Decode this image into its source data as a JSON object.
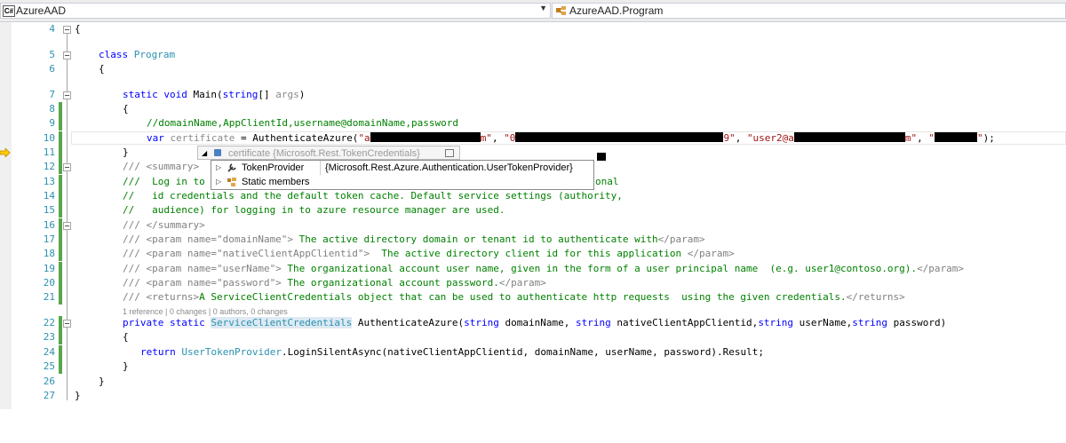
{
  "navbar": {
    "project_icon": "C#",
    "project": "AzureAAD",
    "class_name": "AzureAAD.Program"
  },
  "lines": {
    "l4": {
      "num": "4",
      "code": "{"
    },
    "l5": {
      "num": "5",
      "kw": "class ",
      "ty": "Program"
    },
    "l6": {
      "num": "6",
      "code": "{"
    },
    "l7": {
      "num": "7",
      "kw1": "static ",
      "kw2": "void ",
      "name": "Main(",
      "kw3": "string",
      "rest": "[] ",
      "gray": "args",
      "end": ")"
    },
    "l8": {
      "num": "8",
      "code": "{"
    },
    "l9": {
      "num": "9",
      "comment": "//domainName,AppClientId,username@domainName,password"
    },
    "l10": {
      "num": "10",
      "kw": "var ",
      "var_name": "certificate",
      "mid": " = AuthenticateAzure(",
      "s1a": "\"a",
      "s1b": "m\"",
      "sep1": ", ",
      "s2a": "\"0",
      "s2b": "9\"",
      "sep2": ", ",
      "s3a": "\"user2@a",
      "s3b": "m\"",
      "sep3": ", ",
      "s4a": "\"",
      "s4b": "\"",
      "end": ");"
    },
    "l11": {
      "num": "11",
      "code": "}"
    },
    "l12": {
      "num": "12",
      "code": "/// <summary>"
    },
    "l13": {
      "num": "13",
      "start": "///  Log in to",
      "end": "onal"
    },
    "l14": {
      "num": "14",
      "code": "//   id credentials and the default token cache. Default service settings (authority,"
    },
    "l15": {
      "num": "15",
      "code": "//   audience) for logging in to azure resource manager are used."
    },
    "l16": {
      "num": "16",
      "code": "/// </summary>"
    },
    "l17": {
      "num": "17",
      "tag": "/// <param name=\"domainName\">",
      "text": " The active directory domain or tenant id to authenticate with",
      "close": "</param>"
    },
    "l18": {
      "num": "18",
      "tag": "/// <param name=\"nativeClientAppClientid\">",
      "text": "  The active directory client id for this application ",
      "close": "</param>"
    },
    "l19": {
      "num": "19",
      "tag": "/// <param name=\"userName\">",
      "text": " The organizational account user name, given in the form of a user principal name  (e.g. user1@contoso.org).",
      "close": "</param>"
    },
    "l20": {
      "num": "20",
      "tag": "/// <param name=\"password\">",
      "text": " The organizational account password.",
      "close": "</param>"
    },
    "l21": {
      "num": "21",
      "tag": "/// <returns>",
      "text": "A ServiceClientCredentials object that can be used to authenticate http requests  using the given credentials.",
      "close": "</returns>"
    },
    "lens": "1 reference | 0 changes | 0 authors, 0 changes",
    "l22": {
      "num": "22",
      "kw1": "private ",
      "kw2": "static ",
      "ty": "ServiceClientCredentials",
      "mid": " AuthenticateAzure(",
      "kw3": "string",
      "p1": " domainName, ",
      "kw4": "string",
      "p2": " nativeClientAppClientid,",
      "kw5": "string",
      "p3": " userName,",
      "kw6": "string",
      "p4": " password)"
    },
    "l23": {
      "num": "23",
      "code": "{"
    },
    "l24": {
      "num": "24",
      "kw": "return ",
      "ty": "UserTokenProvider",
      "rest": ".LoginSilentAsync(nativeClientAppClientid, domainName, userName, password).Result;"
    },
    "l25": {
      "num": "25",
      "code": "}"
    },
    "l26": {
      "num": "26",
      "code": "}"
    },
    "l27": {
      "num": "27",
      "code": "}"
    }
  },
  "datatip": {
    "expand": "◢",
    "name": "certificate",
    "type": "{Microsoft.Rest.TokenCredentials}"
  },
  "children": [
    {
      "name": "TokenProvider",
      "value": "{Microsoft.Rest.Azure.Authentication.UserTokenProvider}"
    },
    {
      "name": "Static members",
      "value": ""
    }
  ],
  "colors": {
    "keyword": "#0000ff",
    "type": "#2b91af",
    "comment": "#008000",
    "string": "#a31515",
    "change_bar": "#57a64a"
  }
}
